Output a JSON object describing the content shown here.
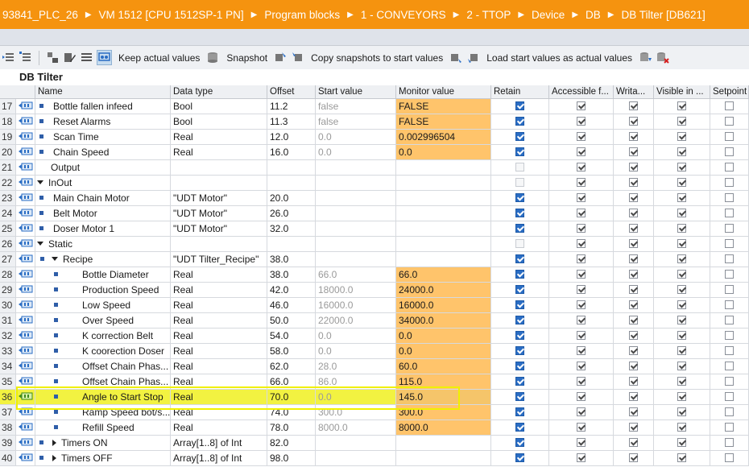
{
  "breadcrumb": [
    "93841_PLC_26",
    "VM 1512 [CPU 1512SP-1 PN]",
    "Program blocks",
    "1 - CONVEYORS",
    "2 - TTOP",
    "Device",
    "DB",
    "DB Tilter [DB621]"
  ],
  "toolbar": {
    "keep_actual_label": "Keep actual values",
    "snapshot_label": "Snapshot",
    "copy_snapshots_label": "Copy snapshots to start values",
    "load_start_label": "Load start values as actual values"
  },
  "editor_title": "DB Tilter",
  "columns": {
    "name": "Name",
    "data_type": "Data type",
    "offset": "Offset",
    "start_value": "Start value",
    "monitor_value": "Monitor value",
    "retain": "Retain",
    "accessible": "Accessible f...",
    "writable": "Writa...",
    "visible": "Visible in ...",
    "setpoint": "Setpoint"
  },
  "rows": [
    {
      "num": "17",
      "name": "Bottle fallen infeed",
      "indent": 2,
      "marker": "bullet",
      "type": "Bool",
      "offset": "11.2",
      "start": "false",
      "monitor": "FALSE",
      "cbs": [
        1,
        1,
        1,
        1,
        0
      ]
    },
    {
      "num": "18",
      "name": "Reset Alarms",
      "indent": 2,
      "marker": "bullet",
      "type": "Bool",
      "offset": "11.3",
      "start": "false",
      "monitor": "FALSE",
      "cbs": [
        1,
        1,
        1,
        1,
        0
      ]
    },
    {
      "num": "19",
      "name": "Scan Time",
      "indent": 2,
      "marker": "bullet",
      "type": "Real",
      "offset": "12.0",
      "start": "0.0",
      "monitor": "0.002996504",
      "cbs": [
        1,
        1,
        1,
        1,
        0
      ]
    },
    {
      "num": "20",
      "name": "Chain Speed",
      "indent": 2,
      "marker": "bullet",
      "type": "Real",
      "offset": "16.0",
      "start": "0.0",
      "monitor": "0.0",
      "cbs": [
        1,
        1,
        1,
        1,
        0
      ]
    },
    {
      "num": "21",
      "name": "Output",
      "indent": 1,
      "marker": "none",
      "type": "",
      "offset": "",
      "start": "",
      "monitor": "",
      "cbs": [
        2,
        1,
        1,
        1,
        0
      ]
    },
    {
      "num": "22",
      "name": "InOut",
      "indent": 1,
      "marker": "down",
      "type": "",
      "offset": "",
      "start": "",
      "monitor": "",
      "cbs": [
        2,
        1,
        1,
        1,
        0
      ]
    },
    {
      "num": "23",
      "name": "Main Chain Motor",
      "indent": 2,
      "marker": "bullet",
      "type": "\"UDT Motor\"",
      "offset": "20.0",
      "start": "",
      "monitor": "",
      "cbs": [
        1,
        1,
        1,
        1,
        0
      ]
    },
    {
      "num": "24",
      "name": "Belt Motor",
      "indent": 2,
      "marker": "bullet",
      "type": "\"UDT Motor\"",
      "offset": "26.0",
      "start": "",
      "monitor": "",
      "cbs": [
        1,
        1,
        1,
        1,
        0
      ]
    },
    {
      "num": "25",
      "name": "Doser Motor 1",
      "indent": 2,
      "marker": "bullet",
      "type": "\"UDT Motor\"",
      "offset": "32.0",
      "start": "",
      "monitor": "",
      "cbs": [
        1,
        1,
        1,
        1,
        0
      ]
    },
    {
      "num": "26",
      "name": "Static",
      "indent": 1,
      "marker": "down",
      "type": "",
      "offset": "",
      "start": "",
      "monitor": "",
      "cbs": [
        2,
        1,
        1,
        1,
        0
      ]
    },
    {
      "num": "27",
      "name": "Recipe",
      "indent": 2,
      "marker": "bullet-down",
      "type": "\"UDT Tilter_Recipe\"",
      "offset": "38.0",
      "start": "",
      "monitor": "",
      "cbs": [
        1,
        1,
        1,
        1,
        0
      ]
    },
    {
      "num": "28",
      "name": "Bottle Diameter",
      "indent": 3,
      "marker": "bullet",
      "type": "Real",
      "offset": "38.0",
      "start": "66.0",
      "monitor": "66.0",
      "cbs": [
        1,
        1,
        1,
        1,
        0
      ]
    },
    {
      "num": "29",
      "name": "Production Speed",
      "indent": 3,
      "marker": "bullet",
      "type": "Real",
      "offset": "42.0",
      "start": "18000.0",
      "monitor": "24000.0",
      "cbs": [
        1,
        1,
        1,
        1,
        0
      ]
    },
    {
      "num": "30",
      "name": "Low Speed",
      "indent": 3,
      "marker": "bullet",
      "type": "Real",
      "offset": "46.0",
      "start": "16000.0",
      "monitor": "16000.0",
      "cbs": [
        1,
        1,
        1,
        1,
        0
      ]
    },
    {
      "num": "31",
      "name": "Over Speed",
      "indent": 3,
      "marker": "bullet",
      "type": "Real",
      "offset": "50.0",
      "start": "22000.0",
      "monitor": "34000.0",
      "cbs": [
        1,
        1,
        1,
        1,
        0
      ]
    },
    {
      "num": "32",
      "name": "K correction Belt",
      "indent": 3,
      "marker": "bullet",
      "type": "Real",
      "offset": "54.0",
      "start": "0.0",
      "monitor": "0.0",
      "cbs": [
        1,
        1,
        1,
        1,
        0
      ]
    },
    {
      "num": "33",
      "name": "K coorection Doser",
      "indent": 3,
      "marker": "bullet",
      "type": "Real",
      "offset": "58.0",
      "start": "0.0",
      "monitor": "0.0",
      "cbs": [
        1,
        1,
        1,
        1,
        0
      ]
    },
    {
      "num": "34",
      "name": "Offset Chain Phas...",
      "indent": 3,
      "marker": "bullet",
      "type": "Real",
      "offset": "62.0",
      "start": "28.0",
      "monitor": "60.0",
      "cbs": [
        1,
        1,
        1,
        1,
        0
      ]
    },
    {
      "num": "35",
      "name": "Offset Chain Phas...",
      "indent": 3,
      "marker": "bullet",
      "type": "Real",
      "offset": "66.0",
      "start": "86.0",
      "monitor": "115.0",
      "cbs": [
        1,
        1,
        1,
        1,
        0
      ]
    },
    {
      "num": "36",
      "name": "Angle to Start Stop",
      "indent": 3,
      "marker": "bullet",
      "type": "Real",
      "offset": "70.0",
      "start": "0.0",
      "monitor": "145.0",
      "cbs": [
        1,
        1,
        1,
        1,
        0
      ],
      "highlight": true
    },
    {
      "num": "37",
      "name": "Ramp Speed bot/s...",
      "indent": 3,
      "marker": "bullet",
      "type": "Real",
      "offset": "74.0",
      "start": "300.0",
      "monitor": "300.0",
      "cbs": [
        1,
        1,
        1,
        1,
        0
      ]
    },
    {
      "num": "38",
      "name": "Refill Speed",
      "indent": 3,
      "marker": "bullet",
      "type": "Real",
      "offset": "78.0",
      "start": "8000.0",
      "monitor": "8000.0",
      "cbs": [
        1,
        1,
        1,
        1,
        0
      ]
    },
    {
      "num": "39",
      "name": "Timers ON",
      "indent": 3,
      "marker": "right",
      "type": "Array[1..8] of Int",
      "offset": "82.0",
      "start": "",
      "monitor": "",
      "cbs": [
        1,
        1,
        1,
        1,
        0
      ]
    },
    {
      "num": "40",
      "name": "Timers OFF",
      "indent": 3,
      "marker": "right",
      "type": "Array[1..8] of Int",
      "offset": "98.0",
      "start": "",
      "monitor": "",
      "cbs": [
        1,
        1,
        1,
        1,
        0
      ]
    }
  ],
  "colors": {
    "accent_orange": "#f5930f",
    "monitor_cell": "#ffc46b",
    "highlight": "#f2f241",
    "checkbox_blue": "#2a6dc4"
  }
}
